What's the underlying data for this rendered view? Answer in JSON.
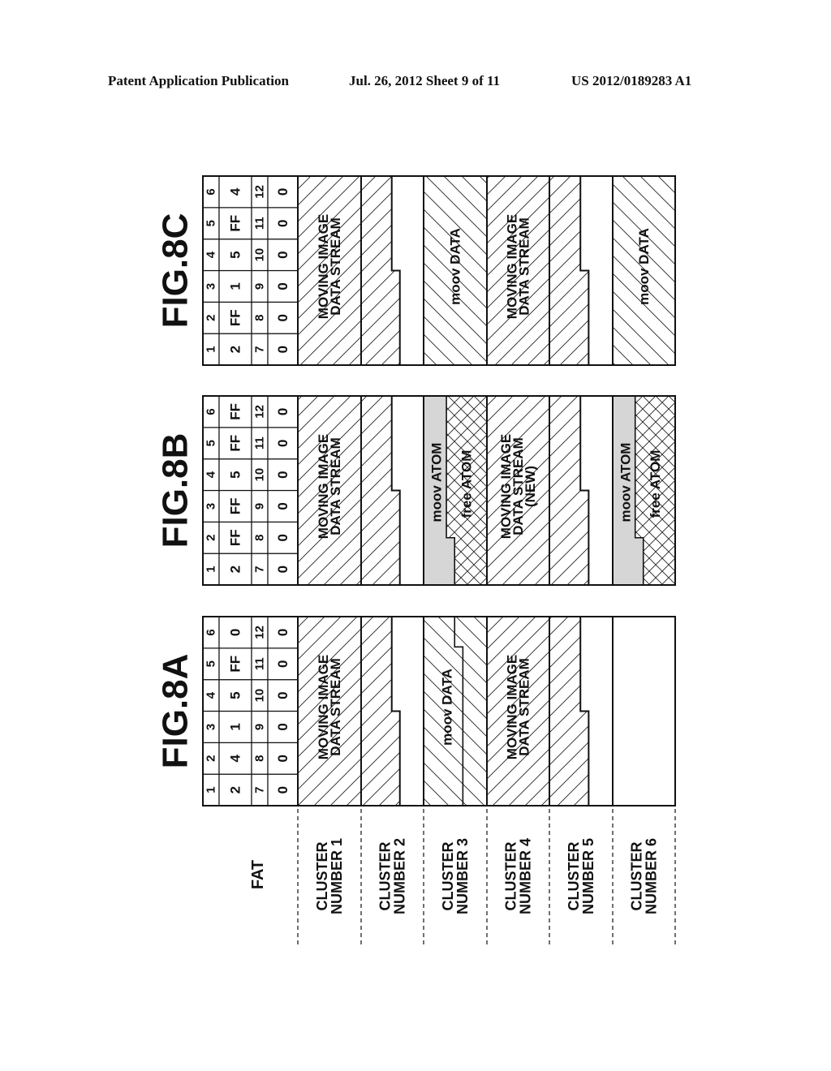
{
  "header": {
    "publication": "Patent Application Publication",
    "date_sheet": "Jul. 26, 2012   Sheet 9 of 11",
    "patent_number": "US 2012/0189283 A1"
  },
  "row_labels": {
    "fat": "FAT",
    "clusters": [
      [
        "CLUSTER",
        "NUMBER 1"
      ],
      [
        "CLUSTER",
        "NUMBER 2"
      ],
      [
        "CLUSTER",
        "NUMBER 3"
      ],
      [
        "CLUSTER",
        "NUMBER 4"
      ],
      [
        "CLUSTER",
        "NUMBER 5"
      ],
      [
        "CLUSTER",
        "NUMBER 6"
      ]
    ]
  },
  "figures": [
    {
      "id": "8A",
      "title": "FIG.8A",
      "fat": {
        "index_row_1": [
          "1",
          "2",
          "3",
          "4",
          "5",
          "6"
        ],
        "value_row_1": [
          "2",
          "4",
          "1",
          "5",
          "FF",
          "0"
        ],
        "index_row_2": [
          "7",
          "8",
          "9",
          "10",
          "11",
          "12"
        ],
        "value_row_2": [
          "0",
          "0",
          "0",
          "0",
          "0",
          "0"
        ]
      },
      "clusters": [
        {
          "content": "MOVING IMAGE DATA STREAM",
          "lines": [
            "MOVING IMAGE",
            "DATA STREAM"
          ],
          "fill": "hatch-slash",
          "span_to_next": true
        },
        {
          "content": "MOVING IMAGE DATA STREAM (continued)",
          "lines": [],
          "fill": "hatch-slash",
          "partial": true
        },
        {
          "content": "moov DATA",
          "lines": [
            "moov DATA"
          ],
          "fill": "hatch-backslash",
          "inner_split": true
        },
        {
          "content": "MOVING IMAGE DATA STREAM",
          "lines": [
            "MOVING IMAGE",
            "DATA STREAM"
          ],
          "fill": "hatch-slash"
        },
        {
          "content": "MOVING IMAGE DATA STREAM (continued)",
          "lines": [],
          "fill": "hatch-slash",
          "partial": true
        },
        {
          "content": "empty",
          "lines": [],
          "fill": "none"
        }
      ]
    },
    {
      "id": "8B",
      "title": "FIG.8B",
      "fat": {
        "index_row_1": [
          "1",
          "2",
          "3",
          "4",
          "5",
          "6"
        ],
        "value_row_1": [
          "2",
          "FF",
          "FF",
          "5",
          "FF",
          "FF"
        ],
        "index_row_2": [
          "7",
          "8",
          "9",
          "10",
          "11",
          "12"
        ],
        "value_row_2": [
          "0",
          "0",
          "0",
          "0",
          "0",
          "0"
        ]
      },
      "clusters": [
        {
          "content": "MOVING IMAGE DATA STREAM",
          "lines": [
            "MOVING IMAGE",
            "DATA STREAM"
          ],
          "fill": "hatch-slash"
        },
        {
          "content": "MOVING IMAGE DATA STREAM (continued)",
          "lines": [],
          "fill": "hatch-slash",
          "partial": true
        },
        {
          "content": "moov ATOM / free ATOM",
          "lines": [
            "moov ATOM"
          ],
          "sublines": [
            "free ATOM"
          ],
          "fill": "grey-crosshatch"
        },
        {
          "content": "MOVING IMAGE DATA STREAM (NEW)",
          "lines": [
            "MOVING IMAGE",
            "DATA STREAM",
            "(NEW)"
          ],
          "fill": "hatch-slash"
        },
        {
          "content": "MOVING IMAGE DATA STREAM (NEW continued)",
          "lines": [],
          "fill": "hatch-slash",
          "partial": true
        },
        {
          "content": "moov ATOM / free ATOM",
          "lines": [
            "moov ATOM"
          ],
          "sublines": [
            "free ATOM"
          ],
          "fill": "grey-crosshatch"
        }
      ]
    },
    {
      "id": "8C",
      "title": "FIG.8C",
      "fat": {
        "index_row_1": [
          "1",
          "2",
          "3",
          "4",
          "5",
          "6"
        ],
        "value_row_1": [
          "2",
          "FF",
          "1",
          "5",
          "FF",
          "4"
        ],
        "index_row_2": [
          "7",
          "8",
          "9",
          "10",
          "11",
          "12"
        ],
        "value_row_2": [
          "0",
          "0",
          "0",
          "0",
          "0",
          "0"
        ]
      },
      "clusters": [
        {
          "content": "MOVING IMAGE DATA STREAM",
          "lines": [
            "MOVING IMAGE",
            "DATA STREAM"
          ],
          "fill": "hatch-slash"
        },
        {
          "content": "MOVING IMAGE DATA STREAM (continued)",
          "lines": [],
          "fill": "hatch-slash",
          "partial": true
        },
        {
          "content": "moov DATA",
          "lines": [
            "moov DATA"
          ],
          "fill": "hatch-backslash"
        },
        {
          "content": "MOVING IMAGE DATA STREAM",
          "lines": [
            "MOVING IMAGE",
            "DATA STREAM"
          ],
          "fill": "hatch-slash"
        },
        {
          "content": "MOVING IMAGE DATA STREAM (continued)",
          "lines": [],
          "fill": "hatch-slash",
          "partial": true
        },
        {
          "content": "moov DATA",
          "lines": [
            "moov DATA"
          ],
          "fill": "hatch-backslash"
        }
      ]
    }
  ],
  "colors": {
    "ink": "#111111",
    "atom_grey": "#d6d6d6",
    "background": "#ffffff"
  }
}
